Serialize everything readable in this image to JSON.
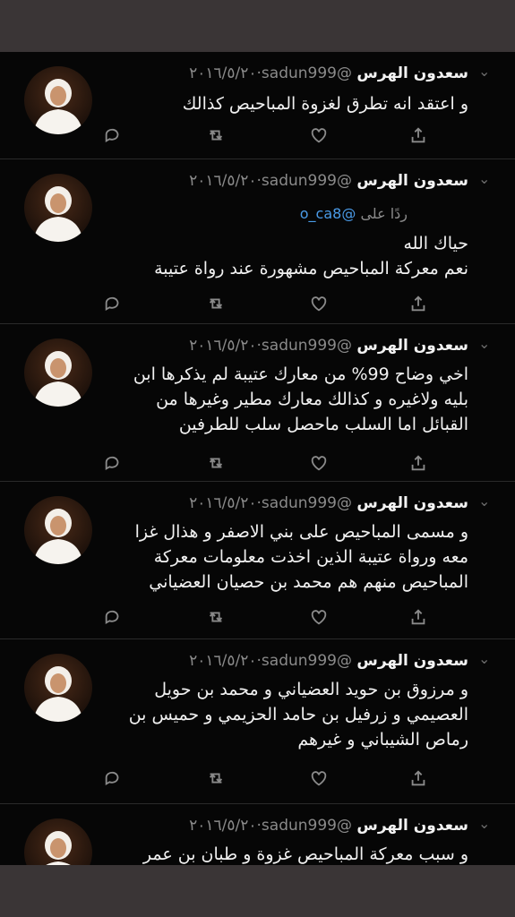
{
  "user": {
    "name": "سعدون الهرس",
    "handle": "@sadun999",
    "date": "٢٠١٦/٥/٢٠"
  },
  "tweets": [
    {
      "lines": [
        "و اعتقد انه تطرق لغزوة المباحيص كذالك"
      ]
    },
    {
      "reply_prefix": "ردًا على",
      "reply_mention": "@o_ca8",
      "lines": [
        "حياك الله",
        "نعم معركة المباحيص مشهورة عند رواة عتيبة"
      ]
    },
    {
      "lines": [
        "اخي وضاح  99% من معارك عتيبة لم يذكرها ابن",
        "بليه ولاغيره و كذالك معارك مطير وغيرها من",
        "القبائل  اما السلب ماحصل سلب للطرفين"
      ]
    },
    {
      "lines": [
        "و مسمى المباحيص على بني الاصفر و هذال غزا",
        "معه ورواة عتيبة الذين اخذت معلومات معركة",
        "المباحيص منهم هم  محمد بن حصيان العضياني"
      ]
    },
    {
      "lines": [
        "و مرزوق بن حويد العضياني و محمد بن حويل",
        "العصيمي و زرفيل بن حامد الحزيمي و حميس بن",
        "رماص الشيباني  و غيرهم"
      ]
    },
    {
      "lines": [
        "و سبب معركة المباحيص  غزوة و طبان بن عمر"
      ]
    }
  ],
  "icons": {
    "reply": "reply-icon",
    "retweet": "retweet-icon",
    "like": "heart-icon",
    "share": "share-icon",
    "menu": "chevron-down-icon"
  },
  "colors": {
    "background": "#060606",
    "frame": "#3a3536",
    "text": "#f0f0f0",
    "muted": "#8a8a8a",
    "link": "#4a9be8"
  }
}
